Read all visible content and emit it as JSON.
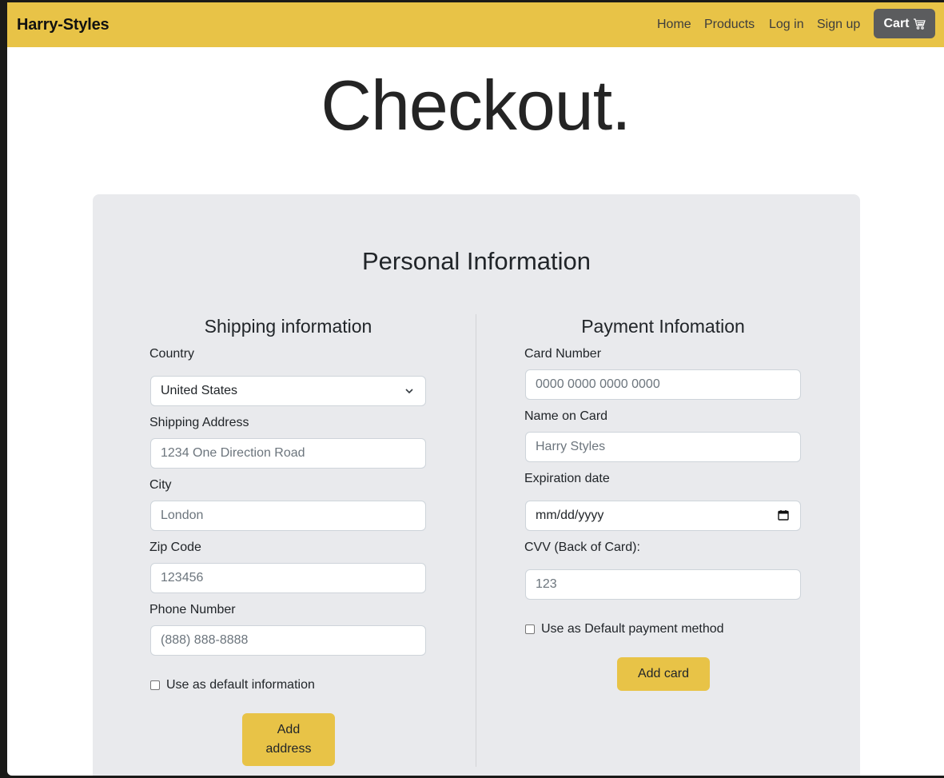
{
  "navbar": {
    "brand": "Harry-Styles",
    "links": [
      "Home",
      "Products",
      "Log in",
      "Sign up"
    ],
    "cart_label": "Cart",
    "accent_color": "#e8c347",
    "cart_icon": "cart-icon"
  },
  "page": {
    "title": "Checkout."
  },
  "panel": {
    "title": "Personal Information"
  },
  "shipping": {
    "title": "Shipping information",
    "country_label": "Country",
    "country_value": "United States",
    "address_label": "Shipping Address",
    "address_placeholder": "1234 One Direction Road",
    "city_label": "City",
    "city_placeholder": "London",
    "zip_label": "Zip Code",
    "zip_placeholder": "123456",
    "phone_label": "Phone Number",
    "phone_placeholder": "(888) 888-8888",
    "default_checkbox_label": "Use as default information",
    "submit_line1": "Add",
    "submit_line2": "address"
  },
  "payment": {
    "title": "Payment Infomation",
    "card_number_label": "Card Number",
    "card_number_placeholder": "0000 0000 0000 0000",
    "name_label": "Name on Card",
    "name_placeholder": "Harry Styles",
    "expiration_label": "Expiration date",
    "expiration_value": "mm/dd/yyyy",
    "cvv_label": "CVV (Back of Card):",
    "cvv_placeholder": "123",
    "default_checkbox_label": "Use as Default payment method",
    "submit_label": "Add card"
  }
}
